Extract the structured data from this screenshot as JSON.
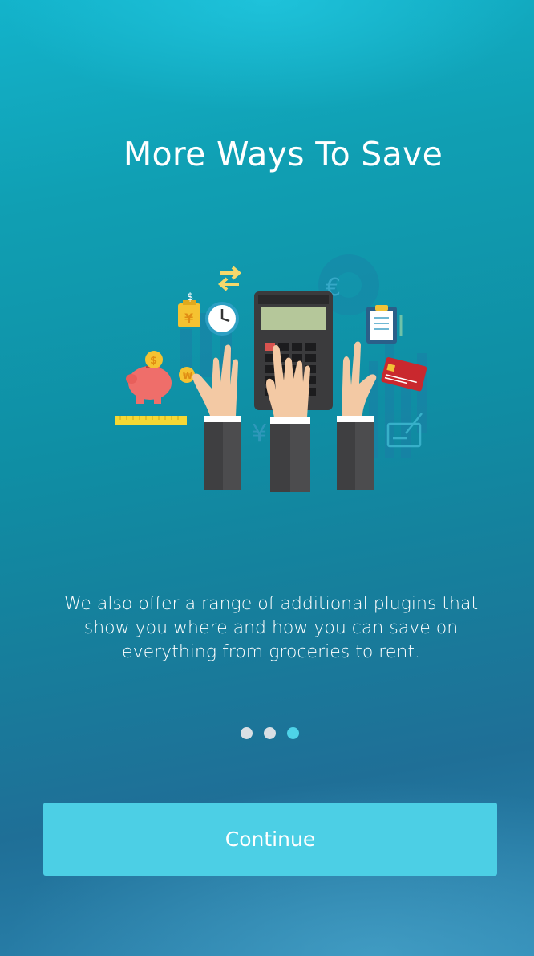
{
  "onboarding": {
    "title": "More Ways To Save",
    "description": "We also offer a range of additional plugins that show you where and how you can save on everything from groceries to rent.",
    "pagination": {
      "total": 3,
      "active": 3
    },
    "continue_label": "Continue"
  },
  "illustration": {
    "icons": [
      "piggy-bank-icon",
      "coin-icon",
      "ruler-icon",
      "money-bag-icon",
      "clock-icon",
      "transfer-arrows-icon",
      "calculator-icon",
      "euro-icon",
      "yen-icon",
      "clipboard-icon",
      "credit-card-icon",
      "cheque-icon"
    ],
    "glyphs": {
      "dollar": "$",
      "euro": "€",
      "yen": "¥"
    }
  },
  "colors": {
    "accent": "#4ccfe5",
    "dot_inactive": "#d9dfe4",
    "dot_active": "#4ed3e8",
    "text": "#ffffff"
  }
}
